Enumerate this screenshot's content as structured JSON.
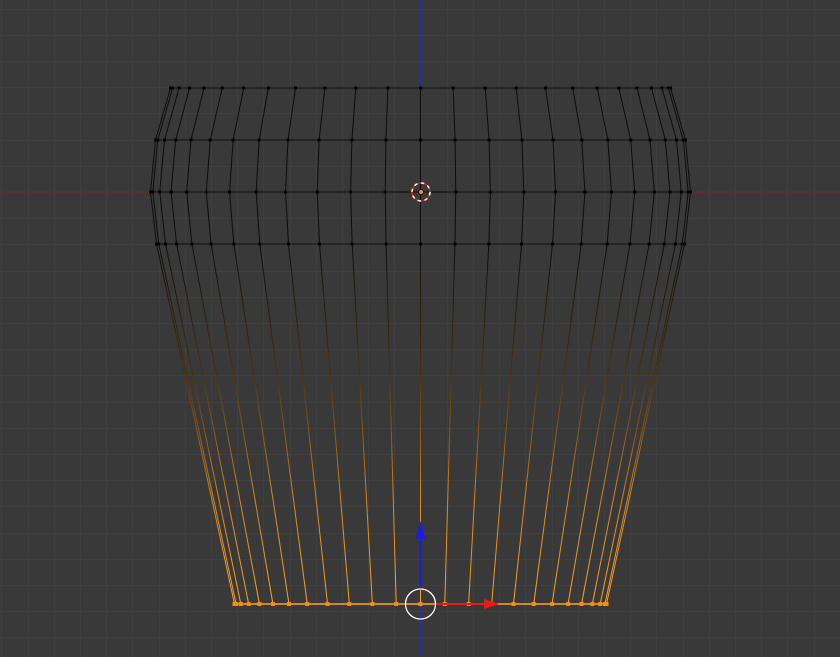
{
  "viewport": {
    "view": "front-orthographic",
    "mode": "edit-mesh",
    "colors": {
      "background": "#393939",
      "grid_minor": "#3f3f3f",
      "grid_major": "#454545",
      "axis_x": "#8c1f1f",
      "axis_z": "#2b2bb0",
      "edge_unselected": "#0d0d0d",
      "edge_selected": "#ffa126",
      "vertex_unselected": "#000000",
      "vertex_selected": "#ff8c00",
      "manipulator_x": "#e81919",
      "manipulator_z": "#1d1de0",
      "manipulator_center": "#ffffff",
      "cursor_ring_red": "#d21e1e",
      "cursor_ring_white": "#ffffff"
    },
    "mesh": {
      "object": "cup-like-mesh",
      "selection": "bottom-edge-loop",
      "ring_count": 5,
      "vertical_edges": 25
    },
    "icons": {
      "manipulator": "transform-manipulator-icon",
      "cursor": "3d-cursor-icon",
      "origin": "object-origin-icon"
    }
  }
}
